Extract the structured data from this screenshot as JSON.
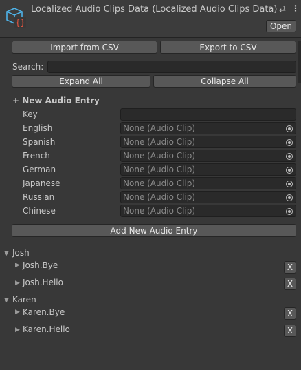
{
  "header": {
    "title": "Localized Audio Clips Data (Localized Audio Clips Data)",
    "open_label": "Open",
    "settings_icon": "sliders-icon",
    "menu_icon": "kebab-menu-icon"
  },
  "toolbar": {
    "import_label": "Import from CSV",
    "export_label": "Export to CSV",
    "search_label": "Search:",
    "search_value": "",
    "expand_label": "Expand All",
    "collapse_label": "Collapse All"
  },
  "new_entry": {
    "heading": "+ New Audio Entry",
    "key_label": "Key",
    "key_value": "",
    "languages": [
      {
        "label": "English",
        "value": "None (Audio Clip)"
      },
      {
        "label": "Spanish",
        "value": "None (Audio Clip)"
      },
      {
        "label": "French",
        "value": "None (Audio Clip)"
      },
      {
        "label": "German",
        "value": "None (Audio Clip)"
      },
      {
        "label": "Japanese",
        "value": "None (Audio Clip)"
      },
      {
        "label": "Russian",
        "value": "None (Audio Clip)"
      },
      {
        "label": "Chinese",
        "value": "None (Audio Clip)"
      }
    ],
    "add_label": "Add New Audio Entry"
  },
  "groups": [
    {
      "name": "Josh",
      "entries": [
        {
          "name": "Josh.Bye",
          "remove": "X"
        },
        {
          "name": "Josh.Hello",
          "remove": "X"
        }
      ]
    },
    {
      "name": "Karen",
      "entries": [
        {
          "name": "Karen.Bye",
          "remove": "X"
        },
        {
          "name": "Karen.Hello",
          "remove": "X"
        }
      ]
    }
  ],
  "colors": {
    "background": "#383838",
    "button": "#585858",
    "field": "#2a2a2a",
    "icon_accent": "#4fb3e8",
    "icon_braces": "#e8553f"
  }
}
